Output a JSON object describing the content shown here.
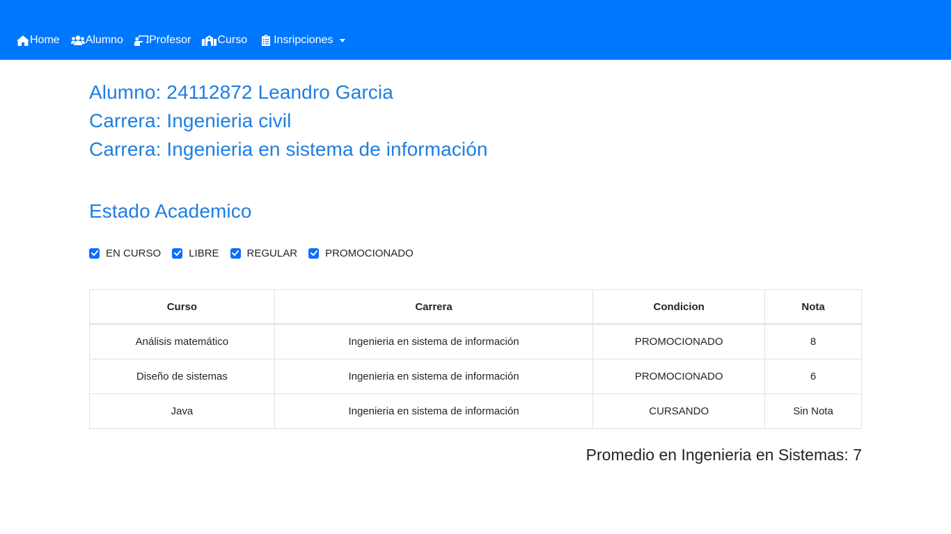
{
  "nav": {
    "items": [
      {
        "label": "Home",
        "icon": "home-icon"
      },
      {
        "label": "Alumno",
        "icon": "users-icon"
      },
      {
        "label": "Profesor",
        "icon": "chalkboard-teacher-icon"
      },
      {
        "label": "Curso",
        "icon": "school-icon"
      }
    ],
    "dropdown": {
      "label": "Insripciones",
      "icon": "clipboard-list-icon"
    }
  },
  "header": {
    "alumno": "Alumno: 24112872 Leandro Garcia",
    "carreras": [
      "Carrera: Ingenieria civil",
      "Carrera: Ingenieria en sistema de información"
    ]
  },
  "section_title": "Estado Academico",
  "filters": [
    {
      "label": "EN CURSO",
      "checked": true
    },
    {
      "label": "LIBRE",
      "checked": true
    },
    {
      "label": "REGULAR",
      "checked": true
    },
    {
      "label": "PROMOCIONADO",
      "checked": true
    }
  ],
  "table": {
    "columns": [
      "Curso",
      "Carrera",
      "Condicion",
      "Nota"
    ],
    "rows": [
      [
        "Análisis matemático",
        "Ingenieria en sistema de información",
        "PROMOCIONADO",
        "8"
      ],
      [
        "Diseño de sistemas",
        "Ingenieria en sistema de información",
        "PROMOCIONADO",
        "6"
      ],
      [
        "Java",
        "Ingenieria en sistema de información",
        "CURSANDO",
        "Sin Nota"
      ]
    ]
  },
  "promedio": "Promedio en Ingenieria en Sistemas: 7",
  "colors": {
    "navbar": "#0077ff",
    "heading": "#1e7ee0",
    "checkbox": "#0d6efd"
  }
}
